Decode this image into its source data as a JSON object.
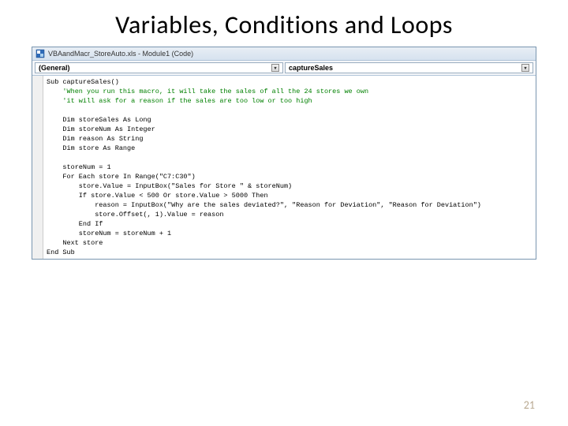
{
  "title": "Variables, Conditions and Loops",
  "vba": {
    "window_title": "VBAandMacr_StoreAuto.xls - Module1 (Code)",
    "dropdown_left": "(General)",
    "dropdown_right": "captureSales",
    "code": {
      "l1": "Sub captureSales()",
      "c1": "    'When you run this macro, it will take the sales of all the 24 stores we own",
      "c2": "    'it will ask for a reason if the sales are too low or too high",
      "l2": "",
      "l3": "    Dim storeSales As Long",
      "l4": "    Dim storeNum As Integer",
      "l5": "    Dim reason As String",
      "l6": "    Dim store As Range",
      "l7": "",
      "l8": "    storeNum = 1",
      "l9": "    For Each store In Range(\"C7:C30\")",
      "l10": "        store.Value = InputBox(\"Sales for Store \" & storeNum)",
      "l11": "        If store.Value < 500 Or store.Value > 5000 Then",
      "l12": "            reason = InputBox(\"Why are the sales deviated?\", \"Reason for Deviation\", \"Reason for Deviation\")",
      "l13": "            store.Offset(, 1).Value = reason",
      "l14": "        End If",
      "l15": "        storeNum = storeNum + 1",
      "l16": "    Next store",
      "l17": "End Sub"
    }
  },
  "page_number": "21"
}
